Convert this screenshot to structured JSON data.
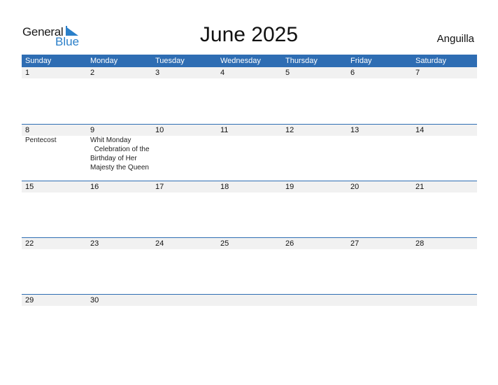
{
  "logo": {
    "general": "General",
    "blue": "Blue"
  },
  "title": "June 2025",
  "country": "Anguilla",
  "colors": {
    "header_bg": "#2e6db3",
    "date_strip_bg": "#f1f1f1",
    "logo_blue": "#2a7fc9"
  },
  "weekdays": [
    "Sunday",
    "Monday",
    "Tuesday",
    "Wednesday",
    "Thursday",
    "Friday",
    "Saturday"
  ],
  "weeks": [
    {
      "days": [
        "1",
        "2",
        "3",
        "4",
        "5",
        "6",
        "7"
      ],
      "events": [
        "",
        "",
        "",
        "",
        "",
        "",
        ""
      ]
    },
    {
      "days": [
        "8",
        "9",
        "10",
        "11",
        "12",
        "13",
        "14"
      ],
      "events": [
        "Pentecost",
        "Whit Monday\n  Celebration of the Birthday of Her Majesty the Queen",
        "",
        "",
        "",
        "",
        ""
      ]
    },
    {
      "days": [
        "15",
        "16",
        "17",
        "18",
        "19",
        "20",
        "21"
      ],
      "events": [
        "",
        "",
        "",
        "",
        "",
        "",
        ""
      ]
    },
    {
      "days": [
        "22",
        "23",
        "24",
        "25",
        "26",
        "27",
        "28"
      ],
      "events": [
        "",
        "",
        "",
        "",
        "",
        "",
        ""
      ]
    },
    {
      "days": [
        "29",
        "30",
        "",
        "",
        "",
        "",
        ""
      ],
      "events": [
        "",
        "",
        "",
        "",
        "",
        "",
        ""
      ]
    }
  ]
}
